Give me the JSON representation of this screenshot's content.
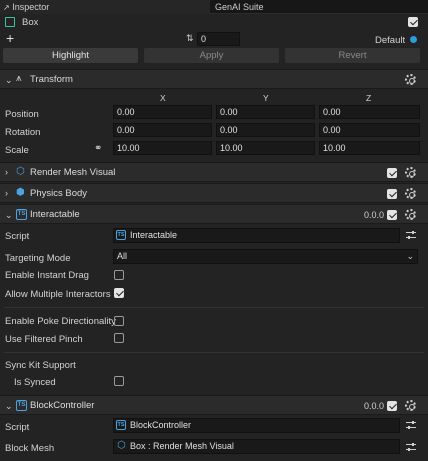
{
  "tabs": {
    "inspector": "Inspector",
    "genai": "GenAI Suite"
  },
  "object": {
    "name": "Box",
    "layer_value": "0",
    "layer_label": "Default"
  },
  "actions": {
    "highlight": "Highlight",
    "apply": "Apply",
    "revert": "Revert"
  },
  "transform": {
    "title": "Transform",
    "axes": {
      "x": "X",
      "y": "Y",
      "z": "Z"
    },
    "position_label": "Position",
    "position": [
      "0.00",
      "0.00",
      "0.00"
    ],
    "rotation_label": "Rotation",
    "rotation": [
      "0.00",
      "0.00",
      "0.00"
    ],
    "scale_label": "Scale",
    "scale": [
      "10.00",
      "10.00",
      "10.00"
    ]
  },
  "render_mesh": {
    "title": "Render Mesh Visual"
  },
  "physics": {
    "title": "Physics Body"
  },
  "interactable": {
    "title": "Interactable",
    "version": "0.0.0",
    "script_label": "Script",
    "script_value": "Interactable",
    "targeting_label": "Targeting Mode",
    "targeting_value": "All",
    "instant_drag_label": "Enable Instant Drag",
    "instant_drag": false,
    "multi_label": "Allow Multiple Interactors",
    "multi": true,
    "poke_label": "Enable Poke Directionality",
    "poke": false,
    "pinch_label": "Use Filtered Pinch",
    "pinch": false,
    "sync_header": "Sync Kit Support",
    "synced_label": "Is Synced",
    "synced": false
  },
  "block": {
    "title": "BlockController",
    "version": "0.0.0",
    "script_label": "Script",
    "script_value": "BlockController",
    "mesh_label": "Block Mesh",
    "mesh_value": "Box : Render Mesh Visual"
  },
  "colors": {
    "accent": "#2d9cdb",
    "script_icon": "#4da3e0"
  }
}
